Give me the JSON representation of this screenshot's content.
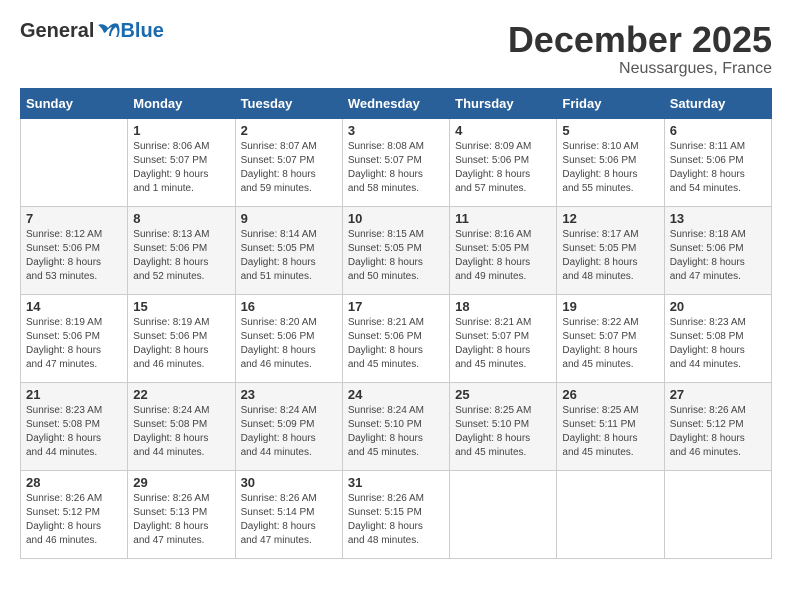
{
  "header": {
    "logo_general": "General",
    "logo_blue": "Blue",
    "month_title": "December 2025",
    "location": "Neussargues, France"
  },
  "days_of_week": [
    "Sunday",
    "Monday",
    "Tuesday",
    "Wednesday",
    "Thursday",
    "Friday",
    "Saturday"
  ],
  "weeks": [
    [
      {
        "day": "",
        "info": ""
      },
      {
        "day": "1",
        "info": "Sunrise: 8:06 AM\nSunset: 5:07 PM\nDaylight: 9 hours\nand 1 minute."
      },
      {
        "day": "2",
        "info": "Sunrise: 8:07 AM\nSunset: 5:07 PM\nDaylight: 8 hours\nand 59 minutes."
      },
      {
        "day": "3",
        "info": "Sunrise: 8:08 AM\nSunset: 5:07 PM\nDaylight: 8 hours\nand 58 minutes."
      },
      {
        "day": "4",
        "info": "Sunrise: 8:09 AM\nSunset: 5:06 PM\nDaylight: 8 hours\nand 57 minutes."
      },
      {
        "day": "5",
        "info": "Sunrise: 8:10 AM\nSunset: 5:06 PM\nDaylight: 8 hours\nand 55 minutes."
      },
      {
        "day": "6",
        "info": "Sunrise: 8:11 AM\nSunset: 5:06 PM\nDaylight: 8 hours\nand 54 minutes."
      }
    ],
    [
      {
        "day": "7",
        "info": "Sunrise: 8:12 AM\nSunset: 5:06 PM\nDaylight: 8 hours\nand 53 minutes."
      },
      {
        "day": "8",
        "info": "Sunrise: 8:13 AM\nSunset: 5:06 PM\nDaylight: 8 hours\nand 52 minutes."
      },
      {
        "day": "9",
        "info": "Sunrise: 8:14 AM\nSunset: 5:05 PM\nDaylight: 8 hours\nand 51 minutes."
      },
      {
        "day": "10",
        "info": "Sunrise: 8:15 AM\nSunset: 5:05 PM\nDaylight: 8 hours\nand 50 minutes."
      },
      {
        "day": "11",
        "info": "Sunrise: 8:16 AM\nSunset: 5:05 PM\nDaylight: 8 hours\nand 49 minutes."
      },
      {
        "day": "12",
        "info": "Sunrise: 8:17 AM\nSunset: 5:05 PM\nDaylight: 8 hours\nand 48 minutes."
      },
      {
        "day": "13",
        "info": "Sunrise: 8:18 AM\nSunset: 5:06 PM\nDaylight: 8 hours\nand 47 minutes."
      }
    ],
    [
      {
        "day": "14",
        "info": "Sunrise: 8:19 AM\nSunset: 5:06 PM\nDaylight: 8 hours\nand 47 minutes."
      },
      {
        "day": "15",
        "info": "Sunrise: 8:19 AM\nSunset: 5:06 PM\nDaylight: 8 hours\nand 46 minutes."
      },
      {
        "day": "16",
        "info": "Sunrise: 8:20 AM\nSunset: 5:06 PM\nDaylight: 8 hours\nand 46 minutes."
      },
      {
        "day": "17",
        "info": "Sunrise: 8:21 AM\nSunset: 5:06 PM\nDaylight: 8 hours\nand 45 minutes."
      },
      {
        "day": "18",
        "info": "Sunrise: 8:21 AM\nSunset: 5:07 PM\nDaylight: 8 hours\nand 45 minutes."
      },
      {
        "day": "19",
        "info": "Sunrise: 8:22 AM\nSunset: 5:07 PM\nDaylight: 8 hours\nand 45 minutes."
      },
      {
        "day": "20",
        "info": "Sunrise: 8:23 AM\nSunset: 5:08 PM\nDaylight: 8 hours\nand 44 minutes."
      }
    ],
    [
      {
        "day": "21",
        "info": "Sunrise: 8:23 AM\nSunset: 5:08 PM\nDaylight: 8 hours\nand 44 minutes."
      },
      {
        "day": "22",
        "info": "Sunrise: 8:24 AM\nSunset: 5:08 PM\nDaylight: 8 hours\nand 44 minutes."
      },
      {
        "day": "23",
        "info": "Sunrise: 8:24 AM\nSunset: 5:09 PM\nDaylight: 8 hours\nand 44 minutes."
      },
      {
        "day": "24",
        "info": "Sunrise: 8:24 AM\nSunset: 5:10 PM\nDaylight: 8 hours\nand 45 minutes."
      },
      {
        "day": "25",
        "info": "Sunrise: 8:25 AM\nSunset: 5:10 PM\nDaylight: 8 hours\nand 45 minutes."
      },
      {
        "day": "26",
        "info": "Sunrise: 8:25 AM\nSunset: 5:11 PM\nDaylight: 8 hours\nand 45 minutes."
      },
      {
        "day": "27",
        "info": "Sunrise: 8:26 AM\nSunset: 5:12 PM\nDaylight: 8 hours\nand 46 minutes."
      }
    ],
    [
      {
        "day": "28",
        "info": "Sunrise: 8:26 AM\nSunset: 5:12 PM\nDaylight: 8 hours\nand 46 minutes."
      },
      {
        "day": "29",
        "info": "Sunrise: 8:26 AM\nSunset: 5:13 PM\nDaylight: 8 hours\nand 47 minutes."
      },
      {
        "day": "30",
        "info": "Sunrise: 8:26 AM\nSunset: 5:14 PM\nDaylight: 8 hours\nand 47 minutes."
      },
      {
        "day": "31",
        "info": "Sunrise: 8:26 AM\nSunset: 5:15 PM\nDaylight: 8 hours\nand 48 minutes."
      },
      {
        "day": "",
        "info": ""
      },
      {
        "day": "",
        "info": ""
      },
      {
        "day": "",
        "info": ""
      }
    ]
  ]
}
